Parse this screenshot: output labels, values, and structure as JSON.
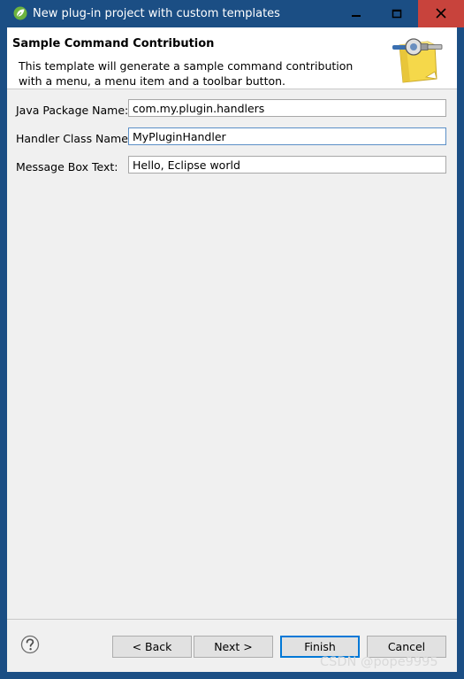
{
  "window": {
    "title": "New plug-in project with custom templates",
    "icon": "spring-leaf-icon"
  },
  "header": {
    "title": "Sample Command Contribution",
    "description": "This template will generate a sample command contribution with a menu, a menu item and a toolbar button.",
    "icon": "plugin-wizard-icon"
  },
  "form": {
    "fields": [
      {
        "label": "Java Package Name:",
        "value": "com.my.plugin.handlers"
      },
      {
        "label": "Handler Class Name:",
        "value": "MyPluginHandler"
      },
      {
        "label": "Message Box Text:",
        "value": "Hello, Eclipse world"
      }
    ]
  },
  "buttons": {
    "back": "< Back",
    "next": "Next >",
    "finish": "Finish",
    "cancel": "Cancel"
  },
  "watermark": "CSDN @pope9995",
  "colors": {
    "titlebar": "#1b4e84",
    "close_button": "#c8433c",
    "focus_border": "#5b8fc7",
    "default_button_border": "#0078d7"
  }
}
